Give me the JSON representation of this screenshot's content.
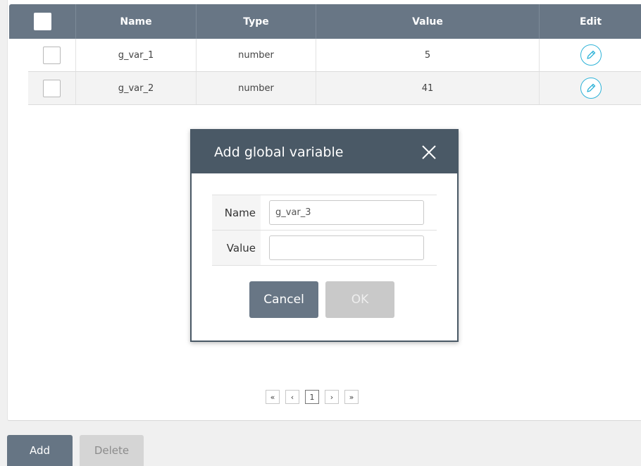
{
  "table": {
    "columns": [
      "Name",
      "Type",
      "Value",
      "Edit"
    ],
    "rows": [
      {
        "name": "g_var_1",
        "type": "number",
        "value": "5"
      },
      {
        "name": "g_var_2",
        "type": "number",
        "value": "41"
      }
    ]
  },
  "pagination": {
    "first": "«",
    "prev": "‹",
    "current_page": "1",
    "next": "›",
    "last": "»"
  },
  "actions": {
    "add_label": "Add",
    "delete_label": "Delete"
  },
  "dialog": {
    "title": "Add global variable",
    "fields": {
      "name_label": "Name",
      "name_value": "g_var_3",
      "value_label": "Value",
      "value_value": ""
    },
    "cancel_label": "Cancel",
    "ok_label": "OK"
  },
  "colors": {
    "header_bg": "#687685",
    "dialog_header_bg": "#4a5966",
    "edit_accent": "#2fb3d8",
    "disabled_bg": "#c9c9c9"
  },
  "icons": {
    "edit": "pencil-icon",
    "close": "close-icon"
  }
}
